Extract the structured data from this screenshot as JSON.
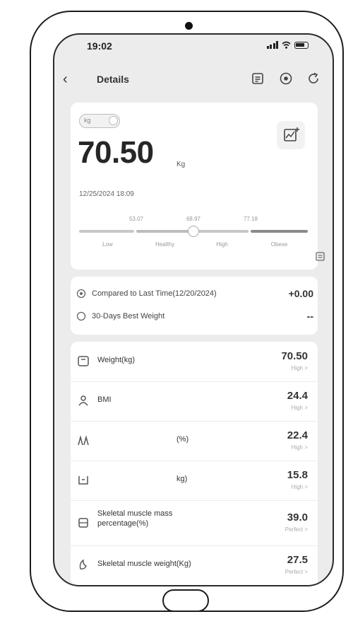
{
  "status_bar": {
    "time": "19:02"
  },
  "nav": {
    "title": "Details"
  },
  "weight_card": {
    "unit_toggle_label": "kg",
    "weight": "70.50",
    "unit": "Kg",
    "measured_at": "12/25/2024 18:09",
    "scale": {
      "thresholds": [
        "53.07",
        "68.97",
        "77.18"
      ],
      "categories": [
        "Low",
        "Healthy",
        "High",
        "Obese"
      ],
      "marker_fraction": 0.5
    }
  },
  "comparison": {
    "last_time_label": "Compared to Last Time(12/20/2024)",
    "last_time_value": "+0.00",
    "best_label": "30-Days Best Weight",
    "best_value": "--"
  },
  "metrics": [
    {
      "label": "Weight(kg)",
      "value": "70.50",
      "status": "High >"
    },
    {
      "label": "BMI",
      "value": "24.4",
      "status": "High >"
    },
    {
      "label": "(%)",
      "value": "22.4",
      "status": "High >"
    },
    {
      "label": "kg)",
      "value": "15.8",
      "status": "High >"
    },
    {
      "label": "Skeletal muscle mass percentage(%)",
      "value": "39.0",
      "status": "Perfect >"
    },
    {
      "label": "Skeletal muscle weight(Kg)",
      "value": "27.5",
      "status": "Perfect >"
    }
  ],
  "colors": {
    "screen_bg": "#ececec",
    "card_bg": "#ffffff",
    "bar_light": "#c8c8c8",
    "bar_dark": "#8a8a8a",
    "text": "#2b2b2b"
  },
  "icons": [
    "back-arrow-icon",
    "report-icon",
    "target-icon",
    "refresh-icon",
    "chart-icon",
    "info-icon",
    "clock-icon",
    "scale-icon",
    "bmi-icon",
    "body-fat-icon",
    "visceral-fat-icon",
    "muscle-icon",
    "muscle-weight-icon"
  ]
}
